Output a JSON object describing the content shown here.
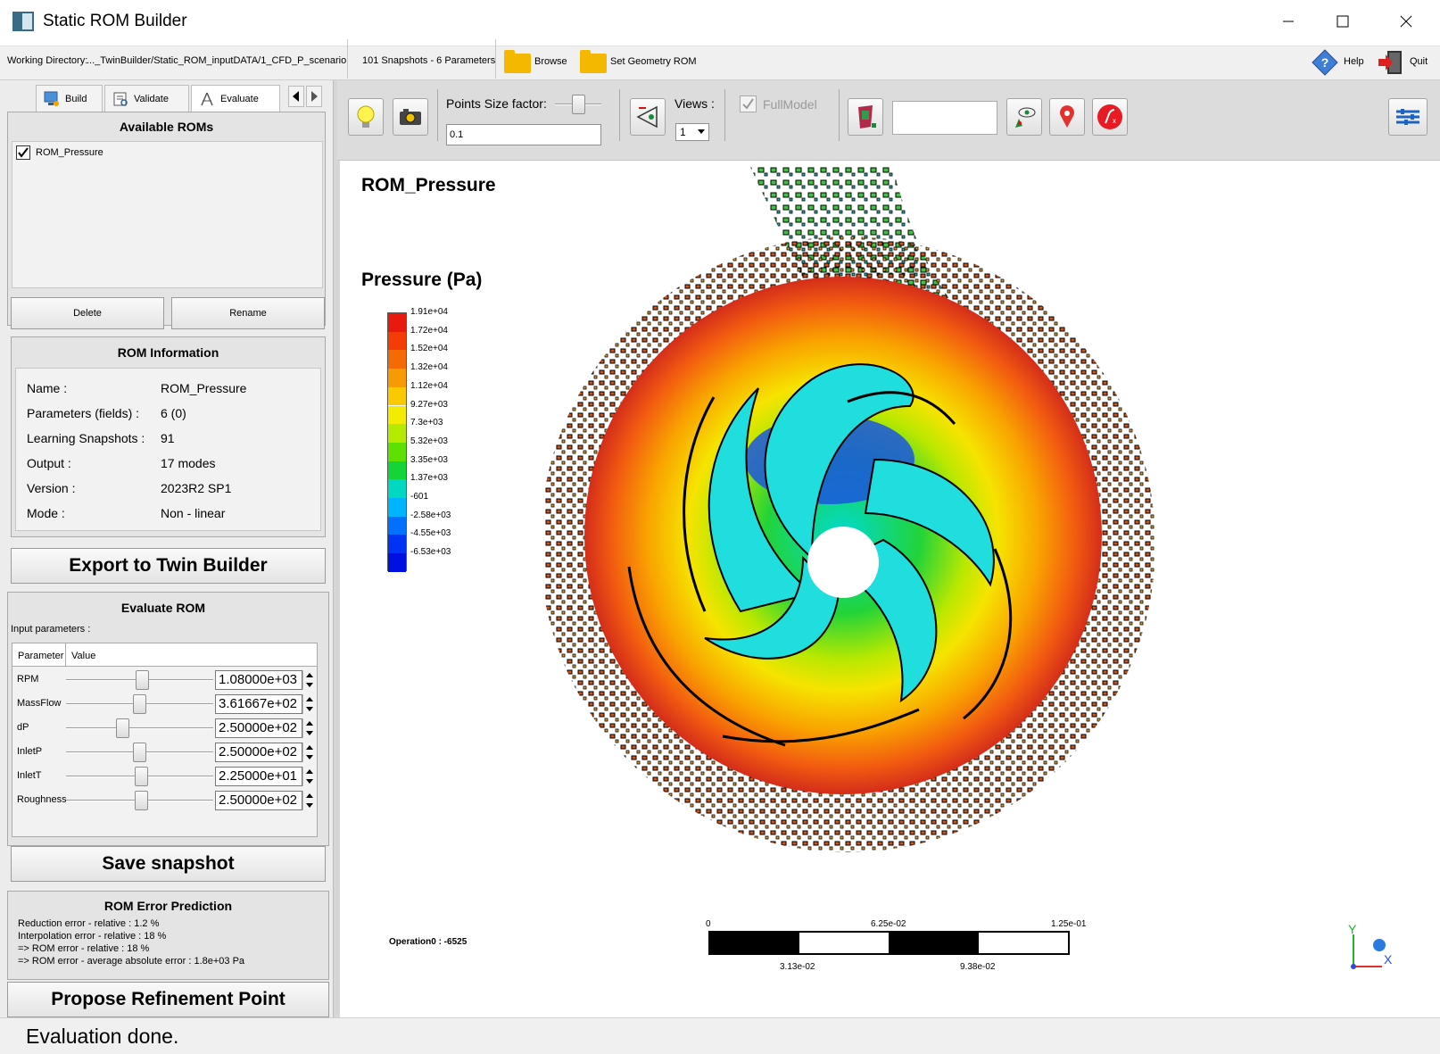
{
  "window": {
    "title": "Static ROM Builder"
  },
  "infobar": {
    "working_dir_label": "Working Directory:",
    "working_dir_value": "..._TwinBuilder/Static_ROM_inputDATA/1_CFD_P_scenario",
    "snapshots": "101 Snapshots - 6 Parameters",
    "browse_label": "Browse",
    "set_geometry_label": "Set Geometry ROM",
    "help_label": "Help",
    "quit_label": "Quit"
  },
  "tabs": {
    "build": "Build",
    "validate": "Validate",
    "evaluate": "Evaluate"
  },
  "available_roms": {
    "title": "Available ROMs",
    "items": [
      {
        "label": "ROM_Pressure",
        "checked": true
      }
    ],
    "delete_label": "Delete",
    "rename_label": "Rename"
  },
  "rom_info": {
    "title": "ROM Information",
    "rows": [
      {
        "key": "Name :",
        "value": "ROM_Pressure"
      },
      {
        "key": "Parameters (fields) :",
        "value": "6 (0)"
      },
      {
        "key": "Learning Snapshots :",
        "value": "91"
      },
      {
        "key": "Output :",
        "value": "17 modes"
      },
      {
        "key": "Version :",
        "value": "2023R2 SP1"
      },
      {
        "key": "Mode :",
        "value": "Non - linear"
      }
    ]
  },
  "export_label": "Export to Twin Builder",
  "evaluate": {
    "title": "Evaluate ROM",
    "input_params_label": "Input parameters :",
    "col_param": "Parameter",
    "col_value": "Value",
    "params": [
      {
        "name": "RPM",
        "value": "1.08000e+03",
        "level": 0.52
      },
      {
        "name": "MassFlow",
        "value": "3.61667e+02",
        "level": 0.5
      },
      {
        "name": "dP",
        "value": "2.50000e+02",
        "level": 0.37
      },
      {
        "name": "InletP",
        "value": "2.50000e+02",
        "level": 0.5
      },
      {
        "name": "InletT",
        "value": "2.25000e+01",
        "level": 0.51
      },
      {
        "name": "Roughness",
        "value": "2.50000e+02",
        "level": 0.51
      }
    ]
  },
  "save_snapshot_label": "Save snapshot",
  "error_prediction": {
    "title": "ROM Error Prediction",
    "lines": [
      "Reduction error - relative : 1.2  %",
      "Interpolation error - relative : 18  %",
      "=> ROM error - relative : 18  %",
      "=> ROM error - average absolute error : 1.8e+03 Pa"
    ]
  },
  "propose_label": "Propose Refinement Point",
  "toolbar": {
    "points_size_label": "Points Size factor:",
    "points_size_value": "0.1",
    "views_label": "Views :",
    "views_value": "1",
    "fullmodel_label": "FullModel",
    "fullmodel_checked": true
  },
  "viewport": {
    "rom_title": "ROM_Pressure",
    "legend_title": "Pressure (Pa)",
    "legend_labels": [
      "1.91e+04",
      "1.72e+04",
      "1.52e+04",
      "1.32e+04",
      "1.12e+04",
      "9.27e+03",
      "7.3e+03",
      "5.32e+03",
      "3.35e+03",
      "1.37e+03",
      "-601",
      "-2.58e+03",
      "-4.55e+03",
      "-6.53e+03"
    ],
    "legend_colors": [
      "#e8190e",
      "#f43c06",
      "#f46a05",
      "#f79a03",
      "#fac900",
      "#f4ec00",
      "#b6ea00",
      "#5ee000",
      "#15d43a",
      "#00d9c2",
      "#00b4ff",
      "#0070ff",
      "#0033f4",
      "#0010e0"
    ],
    "operation_label": "Operation0 : -6525",
    "scalebar_top": [
      "0",
      "6.25e-02",
      "1.25e-01"
    ],
    "scalebar_bottom": [
      "3.13e-02",
      "9.38e-02"
    ],
    "axis_y": "Y",
    "axis_x": "X"
  },
  "status_text": "Evaluation done."
}
